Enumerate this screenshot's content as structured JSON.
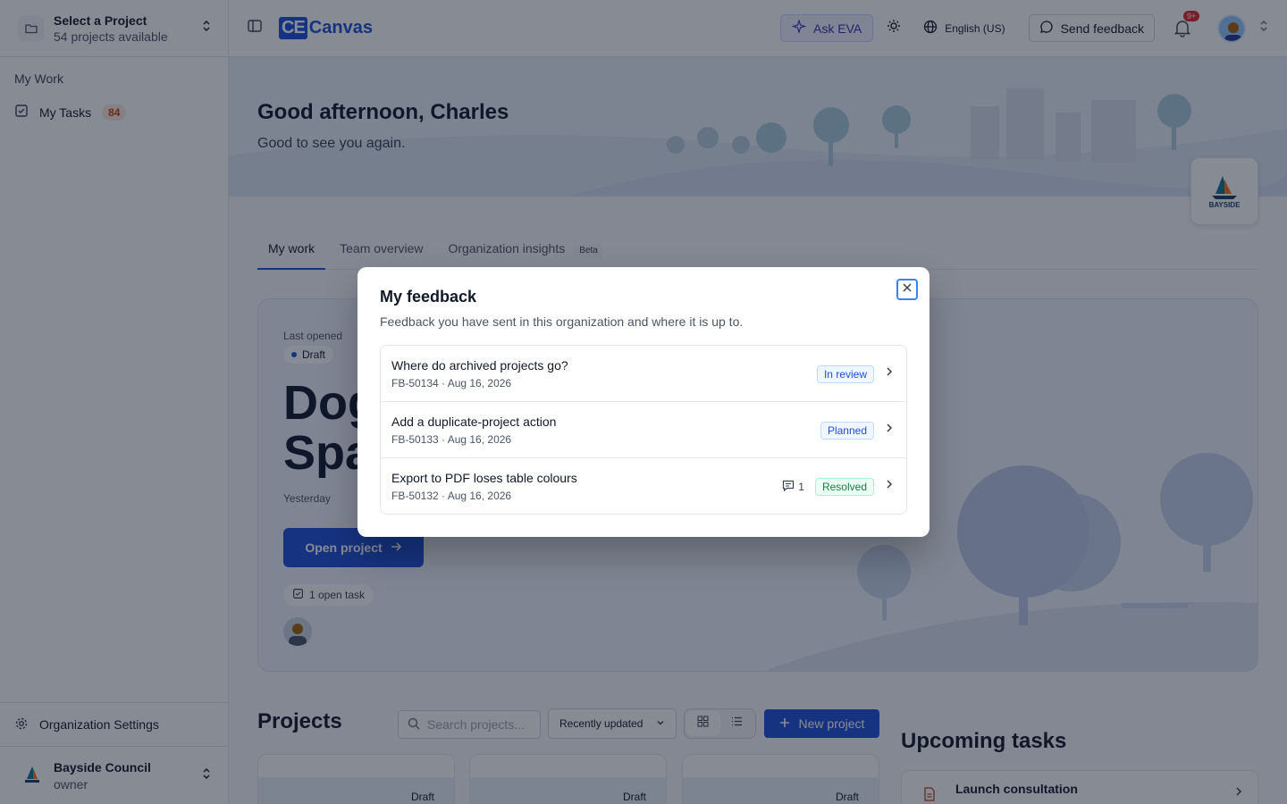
{
  "sidebar": {
    "project_select": {
      "title": "Select a Project",
      "subtitle": "54 projects available"
    },
    "section_heading": "My Work",
    "my_tasks_label": "My Tasks",
    "my_tasks_count": "84",
    "org_settings_label": "Organization Settings",
    "org": {
      "name": "Bayside Council",
      "role": "owner"
    }
  },
  "topbar": {
    "brand_mark": "CE",
    "brand_name": "Canvas",
    "ask_eva": "Ask EVA",
    "language": "English (US)",
    "send_feedback": "Send feedback",
    "notification_badge": "9+"
  },
  "hero": {
    "greeting": "Good afternoon, Charles",
    "subtext": "Good to see you again.",
    "org_logo_text": "BAYSIDE"
  },
  "tabs": [
    {
      "label": "My work",
      "active": true
    },
    {
      "label": "Team overview",
      "active": false
    },
    {
      "label": "Organization insights",
      "active": false,
      "badge": "Beta"
    }
  ],
  "last_opened": {
    "label": "Last opened",
    "status": "Draft",
    "title_visible": "Dog\nSpa",
    "when": "Yesterday",
    "open_button": "Open project",
    "open_tasks": "1 open task"
  },
  "projects": {
    "heading": "Projects",
    "search_placeholder": "Search projects...",
    "sort_value": "Recently updated",
    "new_project": "New project",
    "cards": [
      {
        "status": "Draft"
      },
      {
        "status": "Draft"
      },
      {
        "status": "Draft"
      }
    ]
  },
  "upcoming": {
    "heading": "Upcoming tasks",
    "tasks": [
      {
        "title": "Launch consultation"
      }
    ]
  },
  "modal": {
    "title": "My feedback",
    "subtitle": "Feedback you have sent in this organization and where it is up to.",
    "items": [
      {
        "title": "Where do archived projects go?",
        "meta": "FB-50134 · Aug 16, 2026",
        "status": "In review"
      },
      {
        "title": "Add a duplicate-project action",
        "meta": "FB-50133 · Aug 16, 2026",
        "status": "Planned"
      },
      {
        "title": "Export to PDF loses table colours",
        "meta": "FB-50132 · Aug 16, 2026",
        "status": "Resolved",
        "comments": "1"
      }
    ]
  },
  "colors": {
    "primary": "#1d4ed8",
    "resolved": "#15803d",
    "badge_red": "#dc2626"
  }
}
